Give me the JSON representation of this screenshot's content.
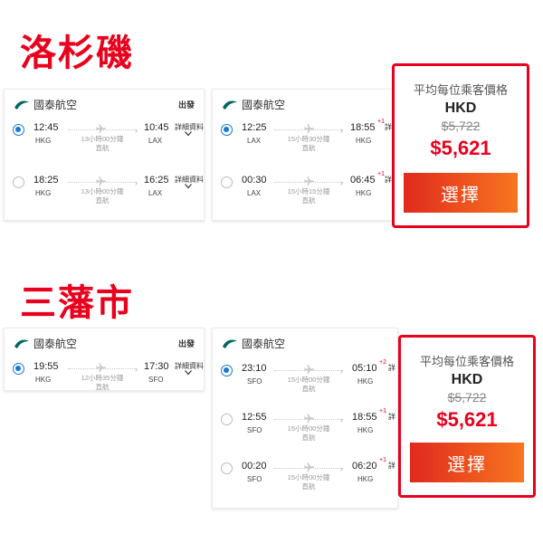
{
  "brand": {
    "accent": "#e8001c",
    "radio": "#1478d4",
    "airline_logo": "cathay-logo-icon"
  },
  "sections": [
    {
      "title": "洛杉磯",
      "outbound": {
        "airline": "國泰航空",
        "direction": "出發",
        "flights": [
          {
            "selected": true,
            "dep_time": "12:45",
            "dep_code": "HKG",
            "arr_time": "10:45",
            "arr_code": "LAX",
            "arr_day": "",
            "duration": "13小時00分鐘",
            "type": "直航",
            "details": "詳細資料"
          },
          {
            "selected": false,
            "dep_time": "18:25",
            "dep_code": "HKG",
            "arr_time": "16:25",
            "arr_code": "LAX",
            "arr_day": "",
            "duration": "13小時00分鐘",
            "type": "直航",
            "details": "詳細資料"
          }
        ]
      },
      "inbound": {
        "airline": "國泰航空",
        "flights": [
          {
            "selected": true,
            "dep_time": "12:25",
            "dep_code": "LAX",
            "arr_time": "18:55",
            "arr_code": "HKG",
            "arr_day": "+1",
            "duration": "15小時30分鐘",
            "type": "直航",
            "details": "詳"
          },
          {
            "selected": false,
            "dep_time": "00:30",
            "dep_code": "LAX",
            "arr_time": "06:45",
            "arr_code": "HKG",
            "arr_day": "+1",
            "duration": "15小時15分鐘",
            "type": "直航",
            "details": "詳"
          }
        ]
      },
      "price": {
        "label": "平均每位乘客價格",
        "currency": "HKD",
        "old_price": "$5,722",
        "new_price": "$5,621",
        "button": "選擇"
      }
    },
    {
      "title": "三藩市",
      "outbound": {
        "airline": "國泰航空",
        "direction": "出發",
        "flights": [
          {
            "selected": true,
            "dep_time": "19:55",
            "dep_code": "HKG",
            "arr_time": "17:30",
            "arr_code": "SFO",
            "arr_day": "",
            "duration": "12小時35分鐘",
            "type": "直航",
            "details": "詳細資料"
          }
        ]
      },
      "inbound": {
        "airline": "國泰航空",
        "flights": [
          {
            "selected": true,
            "dep_time": "23:10",
            "dep_code": "SFO",
            "arr_time": "05:10",
            "arr_code": "HKG",
            "arr_day": "+2",
            "duration": "15小時00分鐘",
            "type": "直航",
            "details": "詳"
          },
          {
            "selected": false,
            "dep_time": "12:55",
            "dep_code": "SFO",
            "arr_time": "18:55",
            "arr_code": "HKG",
            "arr_day": "+1",
            "duration": "15小時00分鐘",
            "type": "直航",
            "details": "詳"
          },
          {
            "selected": false,
            "dep_time": "00:20",
            "dep_code": "SFO",
            "arr_time": "06:20",
            "arr_code": "HKG",
            "arr_day": "+1",
            "duration": "15小時00分鐘",
            "type": "直航",
            "details": "詳"
          }
        ]
      },
      "price": {
        "label": "平均每位乘客價格",
        "currency": "HKD",
        "old_price": "$5,722",
        "new_price": "$5,621",
        "button": "選擇"
      }
    }
  ]
}
